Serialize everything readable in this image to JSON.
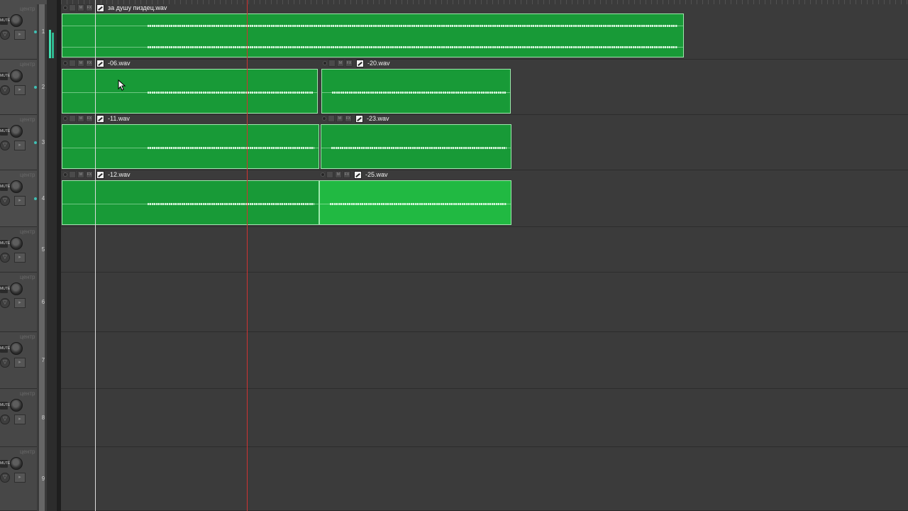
{
  "tracks": [
    {
      "num": "1",
      "pan": "центр",
      "mute": "MUTE",
      "items": [
        {
          "name": "за душу пиздец.wav"
        }
      ]
    },
    {
      "num": "2",
      "pan": "центр",
      "mute": "MUTE",
      "items": [
        {
          "name": "-06.wav"
        },
        {
          "name": "-20.wav"
        }
      ]
    },
    {
      "num": "3",
      "pan": "центр",
      "mute": "MUTE",
      "items": [
        {
          "name": "-11.wav"
        },
        {
          "name": "-23.wav"
        }
      ]
    },
    {
      "num": "4",
      "pan": "центр",
      "mute": "MUTE",
      "items": [
        {
          "name": "-12.wav"
        },
        {
          "name": "-25.wav",
          "selected": true
        }
      ]
    },
    {
      "num": "5",
      "pan": "центр",
      "mute": "MUTE",
      "items": []
    },
    {
      "num": "6",
      "pan": "центр",
      "mute": "MUTE",
      "items": []
    },
    {
      "num": "7",
      "pan": "центр",
      "mute": "MUTE",
      "items": []
    },
    {
      "num": "8",
      "pan": "центр",
      "mute": "MUTE",
      "items": []
    },
    {
      "num": "9",
      "pan": "центр",
      "mute": "MUTE",
      "items": []
    }
  ],
  "colors": {
    "item": "#189a37",
    "item_selected": "#21b942",
    "play_cursor": "#d03232",
    "meter": "#3fe0b0"
  },
  "icons": [
    "pan-knob-icon",
    "record-arm-icon",
    "fx-icon",
    "envelope-icon",
    "mouse-pointer-icon"
  ]
}
